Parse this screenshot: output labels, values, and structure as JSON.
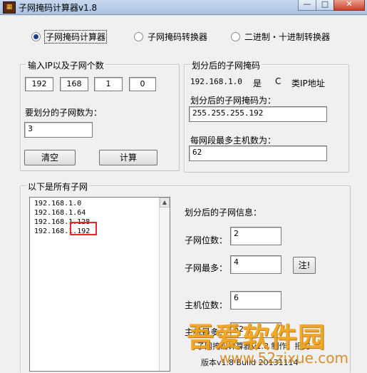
{
  "window": {
    "title": "子网掩码计算器v1.8",
    "controls": {
      "minimize": "—",
      "maximize": "□",
      "close": "✕"
    }
  },
  "modes": {
    "subnet_calc": "子网掩码计算器",
    "mask_convert": "子网掩码转换器",
    "bin_dec_convert": "二进制・十进制转换器"
  },
  "input_group": {
    "title": "输入IP以及子网个数",
    "ip": [
      "192",
      "168",
      "1",
      "0"
    ],
    "subnet_count_label": "要划分的子网数为：",
    "subnet_count_value": "3",
    "clear_button": "清空",
    "calc_button": "计算"
  },
  "mask_group": {
    "title": "划分后的子网掩码",
    "network": "192.168.1.0",
    "is_label": "是",
    "class_value": "C",
    "class_suffix": "类IP地址",
    "mask_label": "划分后的子网掩码为：",
    "mask_value": "255.255.255.192",
    "hosts_label": "每网段最多主机数为：",
    "hosts_value": "62"
  },
  "subnets_group": {
    "title": "以下是所有子网",
    "items": [
      "192.168.1.0",
      "192.168.1.64",
      "192.168.1.128",
      "192.168.1.192"
    ]
  },
  "info": {
    "title": "划分后的子网信息：",
    "subnet_bits_label": "子网位数：",
    "subnet_bits_value": "2",
    "subnet_max_label": "子网最多：",
    "subnet_max_value": "4",
    "note_button": "注!",
    "host_bits_label": "主机位数：",
    "host_bits_value": "6",
    "host_max_label": "主机最多：",
    "host_max_value": "62"
  },
  "footer": {
    "line1": "子网掩码计算器v1.8  制作：把刀",
    "line2": "版本v1.8  Build 20131114"
  },
  "watermark": {
    "brand": "吾爱软件园",
    "url": "www.52zixue.com"
  },
  "colors": {
    "highlight": "#e8262b",
    "watermark": "#f0a21a"
  }
}
